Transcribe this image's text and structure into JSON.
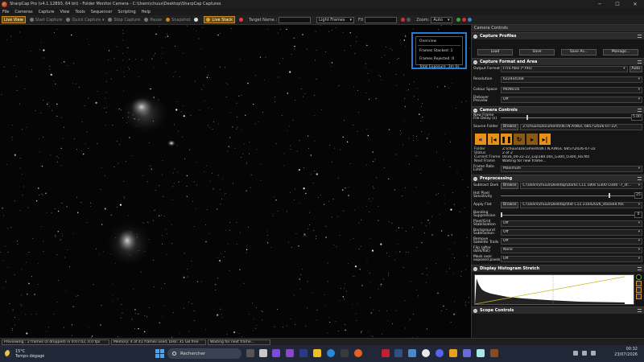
{
  "window": {
    "title": "SharpCap Pro (v4.1.12893, 64 bit) - Folder Monitor Camera - C:\\Users\\chuus\\Desktop\\SharpCap Captures",
    "controls": [
      "─",
      "☐",
      "✕"
    ]
  },
  "menu": [
    "File",
    "Cameras",
    "Capture",
    "View",
    "Tools",
    "Sequencer",
    "Scripting",
    "Help"
  ],
  "toolbar": {
    "live_view": "Live View",
    "start_capture": "Start Capture",
    "quick_capture": "Quick Capture",
    "stop_capture": "Stop Capture",
    "pause": "Pause",
    "snapshot": "Snapshot",
    "live_stack": "Live Stack",
    "target_name_label": "Target Name :",
    "target_name_value": "",
    "frame_type": "Light Frames",
    "fx_label": "FX",
    "fx_value": "",
    "zoom_label": "Zoom:",
    "zoom_value": "Auto"
  },
  "overview": {
    "title": "Overview",
    "frames_stacked_label": "Frames Stacked :",
    "frames_stacked": "1",
    "frames_rejected_label": "Frames Rejected :",
    "frames_rejected": "0",
    "total_exposure_label": "Total Exposure :",
    "total_exposure": "3m 0s"
  },
  "panel": {
    "title": "Camera Controls",
    "capture_profiles": {
      "header": "Capture Profiles",
      "buttons": [
        "Load",
        "Save",
        "Save As...",
        "Manage..."
      ]
    },
    "capture_format": {
      "header": "Capture Format and Area",
      "output_format_label": "Output Format",
      "output_format": "FITS files (*.fits)",
      "auto": "Auto",
      "resolution_label": "Resolution",
      "resolution": "6224x4168",
      "colour_space_label": "Colour Space",
      "colour_space": "MONO16",
      "debayer_label": "Debayer Preview",
      "debayer": "Off"
    },
    "camera_controls": {
      "header": "Camera Controls",
      "new_frame_label": "New Frame File Delay (s)",
      "new_frame_value": "5.00",
      "source_folder_label": "Source Folder",
      "browse": "Browse",
      "source_folder": "Z:\\chuus\\Documents\\N.I.N.A\\NGC 6857\\2026-07-22\\",
      "folder_label": "Folder",
      "folder": "Z:\\chuus\\Documents\\N.I.N.A\\NGC 6857\\2026-07-22",
      "status_label": "Status",
      "status": "2 of 2",
      "current_frame_label": "Current Frame",
      "current_frame": "0030_00-22-22_Exp180.00s_G300_O300_Ha.fits",
      "next_frame_label": "Next Frame",
      "next_frame": "Waiting for new frame...",
      "frame_rate_label": "Frame Rate Limit",
      "frame_rate": "Maximum"
    },
    "preprocessing": {
      "header": "Preprocessing",
      "subtract_dark_label": "Subtract Dark",
      "subtract_dark": "C:\\Users\\chuus\\Desktop\\Darks C11 180s G300 O300 -7_st...",
      "hot_pixel_label": "Hot Pixel Sensitivity",
      "hot_pixel_value": "25",
      "apply_flat_label": "Apply Flat",
      "apply_flat": "C:\\Users\\chuus\\Desktop\\flat C11 21042026_stacked.fits",
      "banding_label": "Banding Suppression",
      "banding_value": "0",
      "pixel_grid_label": "Pixel/Grid Stabilization",
      "pixel_grid": "Off",
      "background_label": "Background Subtraction",
      "background": "Off",
      "satellite_label": "Remove Satellite Trails",
      "satellite": "Off",
      "flip_label": "Flip (after dark/flat)",
      "flip": "None",
      "mask_label": "Mask over exposed pixels",
      "mask": "Off"
    },
    "histogram": {
      "header": "Display Histogram Stretch"
    },
    "scope": {
      "header": "Scope Controls"
    }
  },
  "statusbar": {
    "previewing": "Previewing : 2 frames (0 dropped) in 0:07:02, 0.0 fps",
    "memory": "Memory: 4 of 41 frames used, Disk: 35 GB free",
    "waiting": "Waiting for next frame..."
  },
  "taskbar": {
    "temperature": "15°C",
    "weather": "Temps dégagé",
    "search": "Rechercher",
    "time": "00:32",
    "date": "23/07/2026"
  },
  "colors": {
    "accent_orange": "#e89018",
    "overview_border": "#2a78d8",
    "windows_blue": "#4aa3f0"
  }
}
